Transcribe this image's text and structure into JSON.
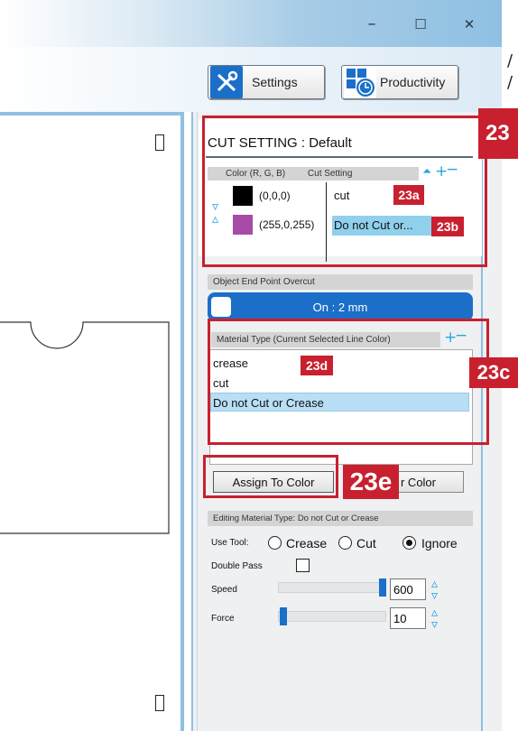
{
  "window": {
    "minimize": "–",
    "maximize": "☐",
    "close": "✕"
  },
  "toolbar": {
    "settings_label": "Settings",
    "productivity_label": "Productivity"
  },
  "cut_setting": {
    "title": "CUT SETTING : Default",
    "col_color": "Color (R, G, B)",
    "col_cut": "Cut Setting",
    "rows": [
      {
        "rgb": "(0,0,0)",
        "swatch": "#000000",
        "setting": "cut"
      },
      {
        "rgb": "(255,0,255)",
        "swatch": "#a64ca6",
        "setting": "Do not Cut or..."
      }
    ]
  },
  "overcut": {
    "header": "Object End Point Overcut",
    "toggle_label": "On : 2 mm"
  },
  "material": {
    "header": "Material Type (Current Selected Line Color)",
    "items": [
      "crease",
      "cut",
      "Do not Cut or Crease"
    ],
    "selected_index": 2
  },
  "buttons": {
    "assign": "Assign To Color",
    "clear_partial": "r Color"
  },
  "editing": {
    "header": "Editing  Material Type: Do not Cut or Crease",
    "use_tool_label": "Use Tool:",
    "tool_options": [
      "Crease",
      "Cut",
      "Ignore"
    ],
    "selected_tool": "Ignore",
    "double_pass_label": "Double Pass",
    "speed_label": "Speed",
    "speed_value": "600",
    "speed_fraction": 1.0,
    "force_label": "Force",
    "force_value": "10",
    "force_fraction": 0.0
  },
  "callouts": {
    "c23": "23",
    "c23a": "23a",
    "c23b": "23b",
    "c23c": "23c",
    "c23d": "23d",
    "c23e": "23e"
  },
  "colors": {
    "accent": "#1b6fc9",
    "callout": "#c8202f",
    "selection": "#b8dff5",
    "frame": "#8fc0e3"
  }
}
